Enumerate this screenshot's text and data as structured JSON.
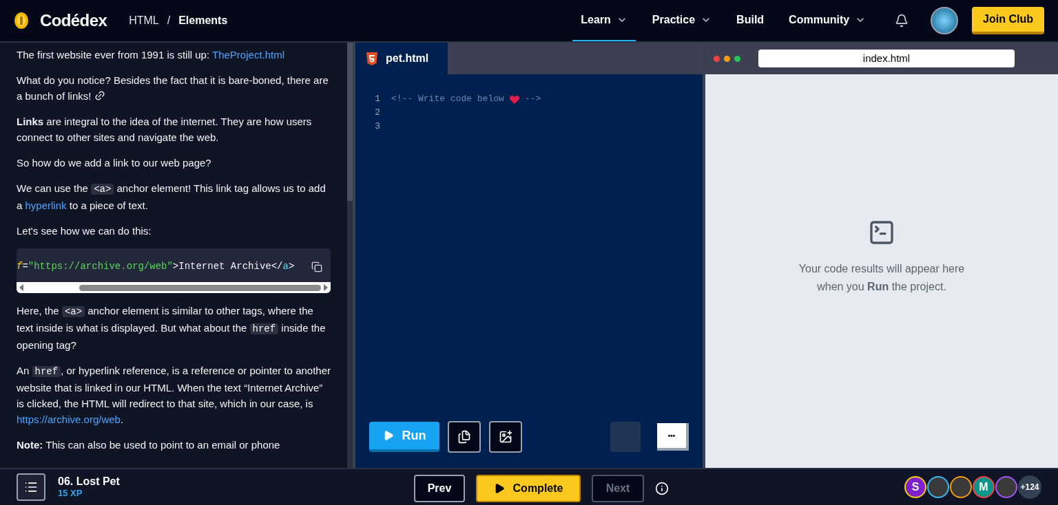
{
  "header": {
    "logo": "Codédex",
    "breadcrumb": [
      {
        "text": "HTML"
      },
      {
        "text": "/"
      },
      {
        "text": "Elements"
      }
    ],
    "nav": [
      {
        "label": "Learn",
        "selected": true,
        "dropdown": true
      },
      {
        "label": "Practice",
        "selected": false,
        "dropdown": true
      },
      {
        "label": "Build",
        "selected": false,
        "dropdown": false
      },
      {
        "label": "Community",
        "selected": false,
        "dropdown": true
      }
    ],
    "join_button": "Join Club"
  },
  "lesson": {
    "blocks": [
      {
        "kind": "para",
        "parts": [
          {
            "kind": "text",
            "text": "The first website ever from 1991 is still up: "
          },
          {
            "kind": "link",
            "text": "TheProject.html"
          }
        ]
      },
      {
        "kind": "para",
        "parts": [
          {
            "kind": "text",
            "text": "What do you notice? Besides the fact that it is bare-boned, there are a bunch of links! "
          },
          {
            "kind": "icon"
          }
        ]
      },
      {
        "kind": "para",
        "parts": [
          {
            "kind": "text",
            "text": "**Links** are integral to the idea of the internet. They are how users connect to other sites and navigate the web."
          }
        ]
      },
      {
        "kind": "para",
        "parts": [
          {
            "kind": "text",
            "text": "So how do we add a link to our web page?"
          }
        ]
      },
      {
        "kind": "para",
        "parts": [
          {
            "kind": "text",
            "text": "We can use the "
          },
          {
            "kind": "code",
            "text": "<a>"
          },
          {
            "kind": "text",
            "text": " anchor element! This link tag allows us to add a "
          },
          {
            "kind": "link",
            "text": "hyperlink"
          },
          {
            "kind": "text",
            "text": " to a piece of text."
          }
        ]
      },
      {
        "kind": "para",
        "parts": [
          {
            "kind": "text",
            "text": "Let's see how we can do this:"
          }
        ]
      },
      {
        "kind": "codeblock",
        "tokens": [
          {
            "kind": "attr",
            "text": "f"
          },
          {
            "kind": "plain",
            "text": "="
          },
          {
            "kind": "string",
            "text": "\"https://archive.org/web\""
          },
          {
            "kind": "plain",
            "text": ">Internet Archive</"
          },
          {
            "kind": "tag",
            "text": "a"
          },
          {
            "kind": "plain",
            "text": ">"
          }
        ]
      },
      {
        "kind": "para",
        "parts": [
          {
            "kind": "text",
            "text": "Here, the "
          },
          {
            "kind": "code",
            "text": "<a>"
          },
          {
            "kind": "text",
            "text": " anchor element is similar to other tags, where the text inside is what is displayed. But what about the "
          },
          {
            "kind": "code",
            "text": "href"
          },
          {
            "kind": "text",
            "text": " inside the opening tag?"
          }
        ]
      },
      {
        "kind": "para",
        "parts": [
          {
            "kind": "text",
            "text": "An "
          },
          {
            "kind": "code",
            "text": "href"
          },
          {
            "kind": "text",
            "text": ", or hyperlink reference, is a reference or pointer to another website that is linked in our HTML. When the text “Internet Archive” is clicked, the HTML will redirect to that site, which in our case, is "
          },
          {
            "kind": "link",
            "text": "https://archive.org/web"
          },
          {
            "kind": "text",
            "text": "."
          }
        ]
      },
      {
        "kind": "para",
        "parts": [
          {
            "kind": "text",
            "text": "**Note:** This can also be used to point to an email or phone"
          }
        ]
      }
    ]
  },
  "editor": {
    "tabs": [
      {
        "label": "pet.html",
        "selected": true
      }
    ],
    "lines": [
      {
        "number": "1",
        "tokens": [
          {
            "kind": "comment",
            "text": "<!-- Write code below"
          },
          {
            "kind": "heart"
          },
          {
            "kind": "comment",
            "text": "-->"
          }
        ]
      },
      {
        "number": "2"
      },
      {
        "number": "3"
      }
    ],
    "run_button": "Run",
    "more_button": "•••"
  },
  "preview": {
    "address": "index.html",
    "message": "Your code results will appear here when you **Run** the project."
  },
  "footer": {
    "lesson_title": "06. Lost Pet",
    "xp": "15 XP",
    "buttons": [
      {
        "kind": "prev",
        "label": "Prev",
        "disabled": false
      },
      {
        "kind": "complete",
        "label": "Complete",
        "disabled": false
      },
      {
        "kind": "next",
        "label": "Next",
        "disabled": true
      }
    ],
    "avatars": [
      {
        "kind": "letter",
        "text": "S",
        "color": "#facc15"
      },
      {
        "kind": "photo",
        "color": "#38bdf8"
      },
      {
        "kind": "photo",
        "color": "#f59e0b"
      },
      {
        "kind": "letter",
        "text": "M",
        "color": "#ef4444"
      },
      {
        "kind": "photo",
        "color": "#a855f7"
      },
      {
        "kind": "count",
        "text": "+124",
        "color": "#334155"
      }
    ]
  }
}
